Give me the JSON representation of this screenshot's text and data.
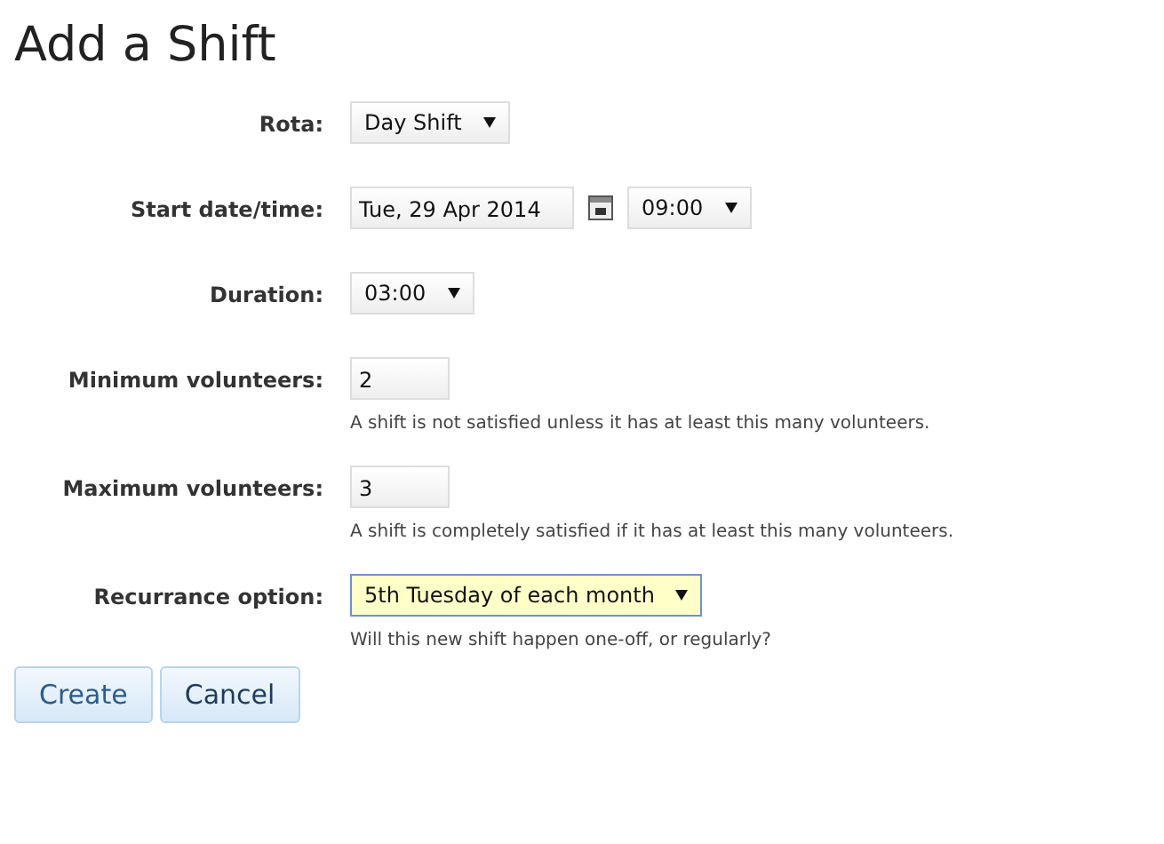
{
  "title": "Add a Shift",
  "fields": [
    {
      "kind": "select",
      "label": "Rota:",
      "value": "Day Shift",
      "focused": false
    },
    {
      "kind": "datetime",
      "label": "Start date/time:",
      "date": "Tue, 29 Apr 2014",
      "time": "09:00"
    },
    {
      "kind": "select",
      "label": "Duration:",
      "value": "03:00",
      "focused": false
    },
    {
      "kind": "input",
      "label": "Minimum volunteers:",
      "value": "2",
      "hint": "A shift is not satisfied unless it has at least this many volunteers."
    },
    {
      "kind": "input",
      "label": "Maximum volunteers:",
      "value": "3",
      "hint": "A shift is completely satisfied if it has at least this many volunteers."
    },
    {
      "kind": "select",
      "label": "Recurrance option:",
      "value": "5th Tuesday of each month",
      "focused": true,
      "hint": "Will this new shift happen one-off, or regularly?"
    }
  ],
  "buttons": [
    "Create",
    "Cancel"
  ]
}
